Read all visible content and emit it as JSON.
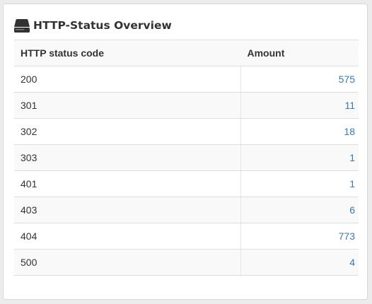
{
  "panel": {
    "title": "HTTP-Status Overview",
    "icon": "hdd-drive-icon"
  },
  "table": {
    "headers": [
      "HTTP status code",
      "Amount"
    ],
    "rows": [
      {
        "code": "200",
        "amount": "575"
      },
      {
        "code": "301",
        "amount": "11"
      },
      {
        "code": "302",
        "amount": "18"
      },
      {
        "code": "303",
        "amount": "1"
      },
      {
        "code": "401",
        "amount": "1"
      },
      {
        "code": "403",
        "amount": "6"
      },
      {
        "code": "404",
        "amount": "773"
      },
      {
        "code": "500",
        "amount": "4"
      }
    ]
  },
  "colors": {
    "link": "#337ab7",
    "striped_row": "#f9f9f9",
    "border": "#dddddd"
  }
}
